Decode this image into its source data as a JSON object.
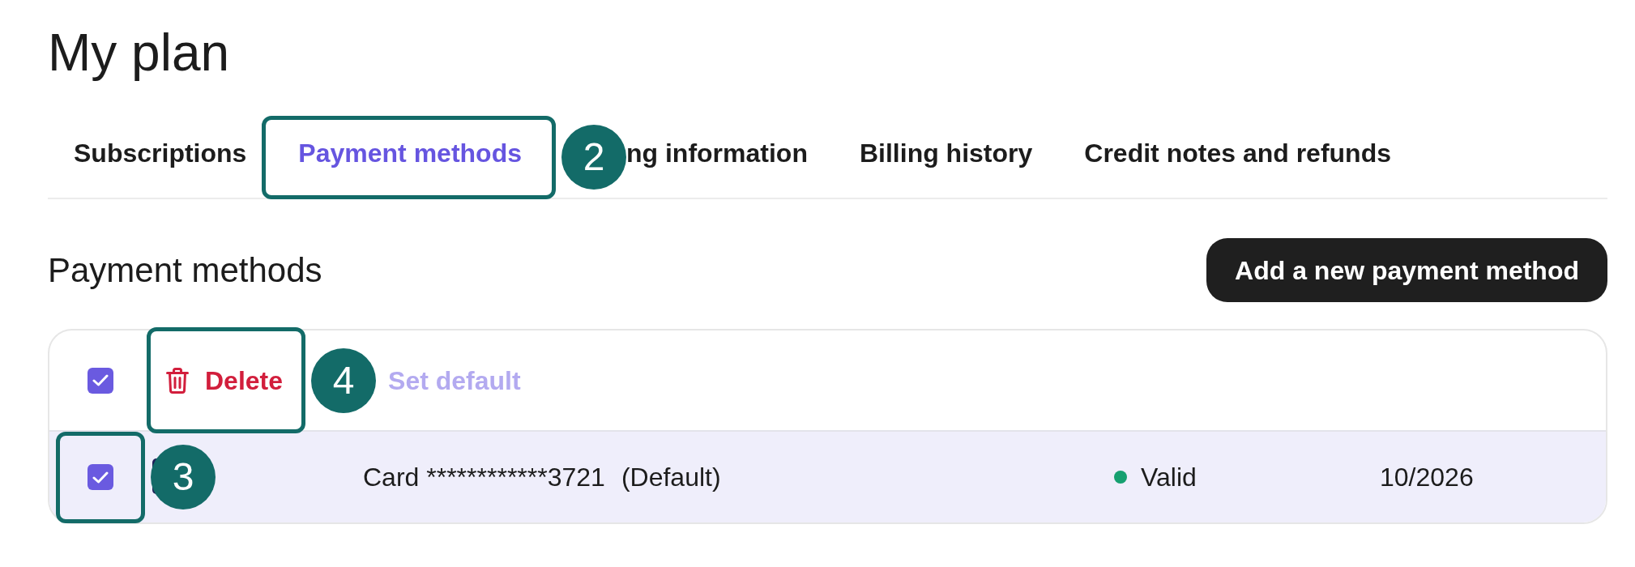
{
  "page": {
    "title": "My plan"
  },
  "tabs": [
    {
      "label": "Subscriptions",
      "selected": false
    },
    {
      "label": "Payment methods",
      "selected": true,
      "callout": "2"
    },
    {
      "label": "ng information",
      "selected": false
    },
    {
      "label": "Billing history",
      "selected": false
    },
    {
      "label": "Credit notes and refunds",
      "selected": false
    }
  ],
  "section": {
    "title": "Payment methods",
    "action": "Add a new payment method"
  },
  "table": {
    "select_all": {
      "checked": true
    },
    "actions": [
      {
        "kind": "destructive",
        "label": "Delete",
        "disabled": false,
        "callout": "4"
      },
      {
        "kind": "primary",
        "label": "Set default",
        "disabled": true
      }
    ],
    "rows": [
      {
        "selected": true,
        "callout": "3",
        "card": "Card ************3721",
        "note": "(Default)",
        "status": {
          "label": "Valid",
          "color": "#16a070"
        },
        "expiry": "10/2026"
      }
    ]
  }
}
